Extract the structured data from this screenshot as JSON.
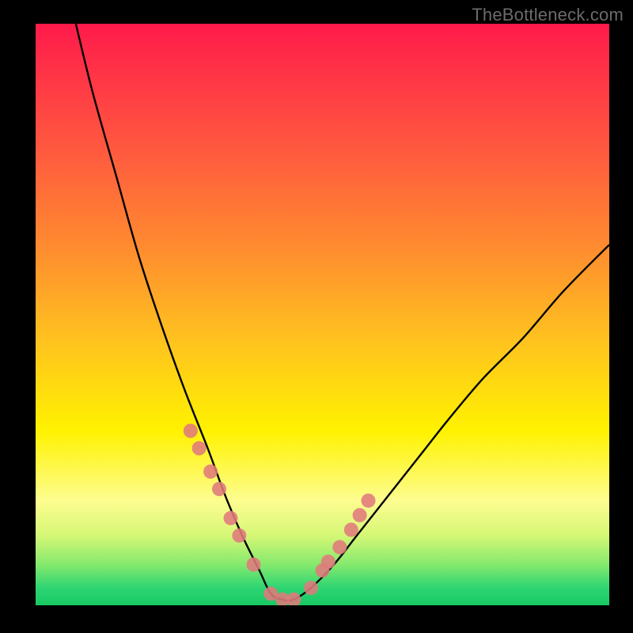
{
  "watermark": "TheBottleneck.com",
  "colors": {
    "frame": "#000000",
    "curve": "#000000",
    "dot": "#e07a7c"
  },
  "chart_data": {
    "type": "line",
    "title": "",
    "xlabel": "",
    "ylabel": "",
    "xlim": [
      0,
      100
    ],
    "ylim": [
      0,
      100
    ],
    "grid": false,
    "series": [
      {
        "name": "bottleneck-curve",
        "description": "V-shaped curve; y is mismatch percentage (0 = ideal), minimum at x≈42",
        "x": [
          7,
          10,
          14,
          18,
          22,
          26,
          30,
          33,
          36,
          39,
          41,
          43,
          45,
          48,
          52,
          56,
          60,
          64,
          68,
          72,
          78,
          85,
          92,
          100
        ],
        "y": [
          100,
          88,
          74,
          60,
          48,
          37,
          27,
          19,
          12,
          6,
          2,
          1,
          1,
          3,
          7,
          12,
          17,
          22,
          27,
          32,
          39,
          46,
          54,
          62
        ]
      }
    ],
    "markers": {
      "name": "highlighted-points",
      "description": "salmon dots overlaid on the curve near the valley and shoulders",
      "x": [
        27,
        28.5,
        30.5,
        32,
        34,
        35.5,
        38,
        41,
        43,
        45,
        48,
        50,
        51,
        53,
        55,
        56.5,
        58
      ],
      "y": [
        30,
        27,
        23,
        20,
        15,
        12,
        7,
        2,
        1,
        1,
        3,
        6,
        7.5,
        10,
        13,
        15.5,
        18
      ]
    }
  }
}
